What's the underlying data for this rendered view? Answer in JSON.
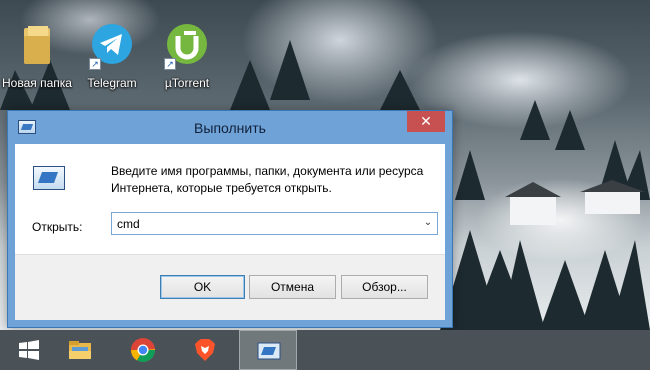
{
  "desktop": {
    "icons": [
      {
        "label": "Новая папка",
        "icon": "folder-icon"
      },
      {
        "label": "Telegram",
        "icon": "telegram-icon"
      },
      {
        "label": "µTorrent",
        "icon": "utorrent-icon"
      }
    ]
  },
  "dialog": {
    "title": "Выполнить",
    "close_glyph": "✕",
    "description_line1": "Введите имя программы, папки, документа или ресурса",
    "description_line2": "Интернета, которые требуется открыть.",
    "open_label": "Открыть:",
    "input_value": "cmd",
    "dropdown_glyph": "⌄",
    "buttons": {
      "ok": "OK",
      "cancel": "Отмена",
      "browse": "Обзор..."
    }
  },
  "taskbar": {
    "items": [
      {
        "icon": "windows-start-icon",
        "active": false
      },
      {
        "icon": "file-explorer-icon",
        "active": false
      },
      {
        "icon": "chrome-icon",
        "active": false
      },
      {
        "icon": "brave-icon",
        "active": false
      },
      {
        "icon": "run-dialog-icon",
        "active": true
      }
    ]
  },
  "colors": {
    "title_bar": "#6fa3d8",
    "close_button": "#c75050",
    "taskbar": "#4a5258",
    "telegram": "#2ca5e0",
    "utorrent": "#76b83f"
  }
}
